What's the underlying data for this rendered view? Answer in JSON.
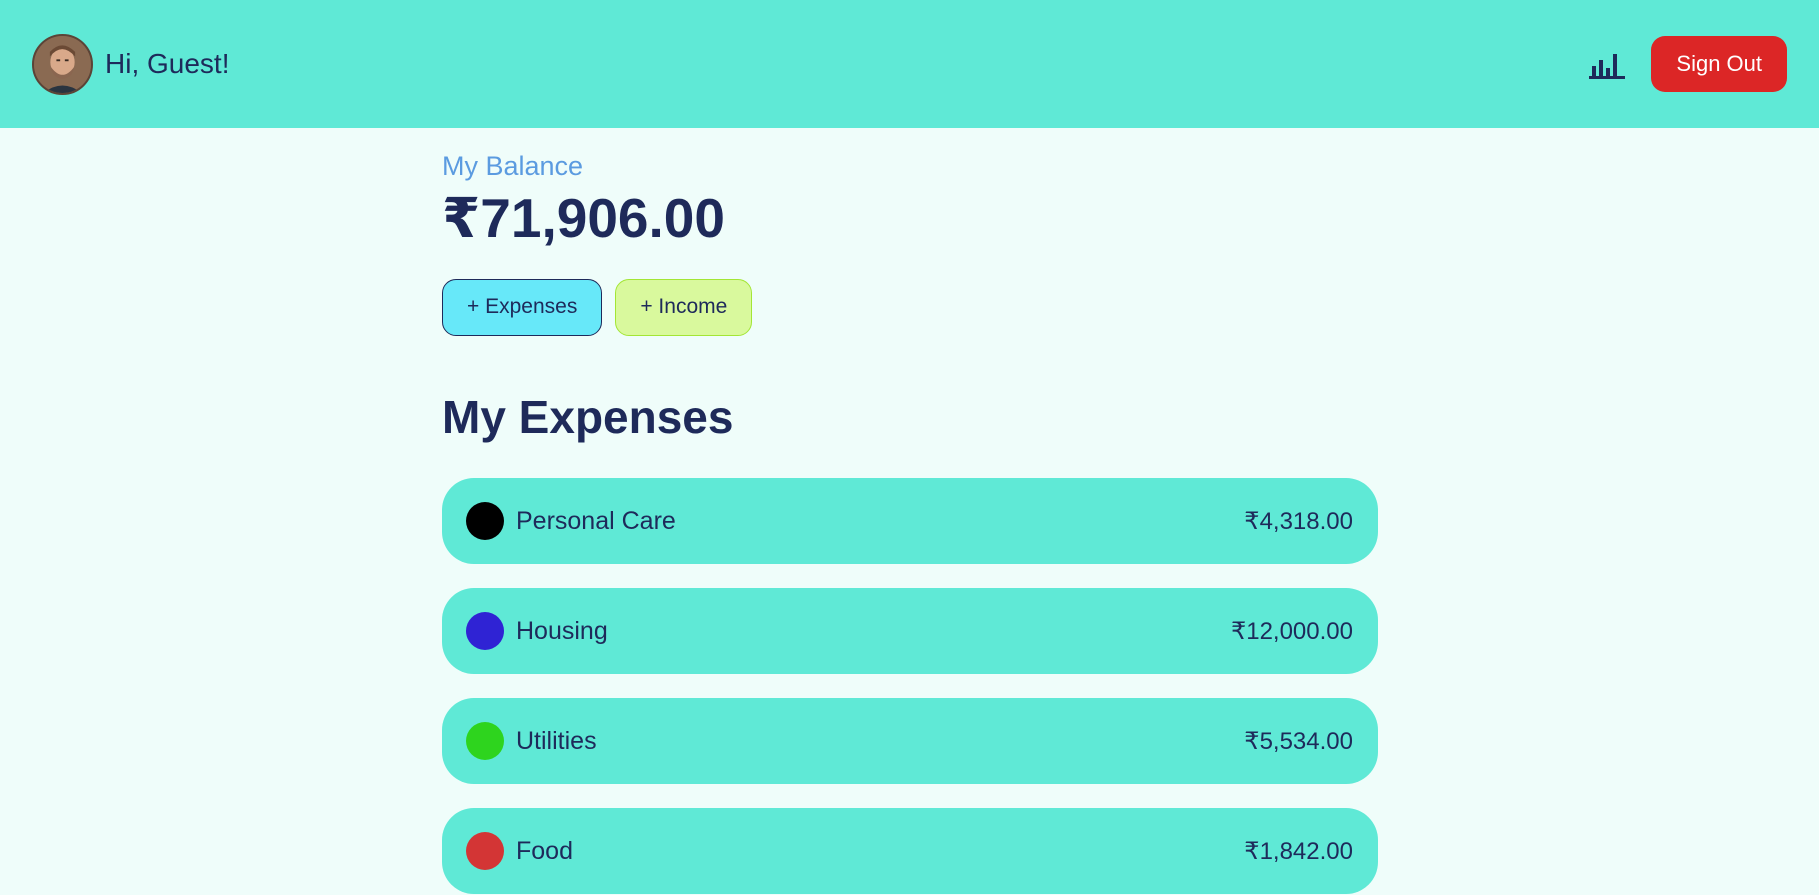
{
  "header": {
    "greeting": "Hi, Guest!",
    "avatar_icon": "user-avatar",
    "chart_icon": "bar-chart-icon",
    "signout_label": "Sign Out",
    "signout_color": "#dc2626",
    "background_color": "#5fe9d6"
  },
  "balance": {
    "label": "My Balance",
    "value": "₹71,906.00"
  },
  "actions": {
    "expenses_label": "+ Expenses",
    "income_label": "+ Income"
  },
  "expenses": {
    "title": "My Expenses",
    "items": [
      {
        "name": "Personal Care",
        "amount": "₹4,318.00",
        "color": "#000000"
      },
      {
        "name": "Housing",
        "amount": "₹12,000.00",
        "color": "#2f23d4"
      },
      {
        "name": "Utilities",
        "amount": "₹5,534.00",
        "color": "#2ed41e"
      },
      {
        "name": "Food",
        "amount": "₹1,842.00",
        "color": "#d33535"
      }
    ]
  }
}
